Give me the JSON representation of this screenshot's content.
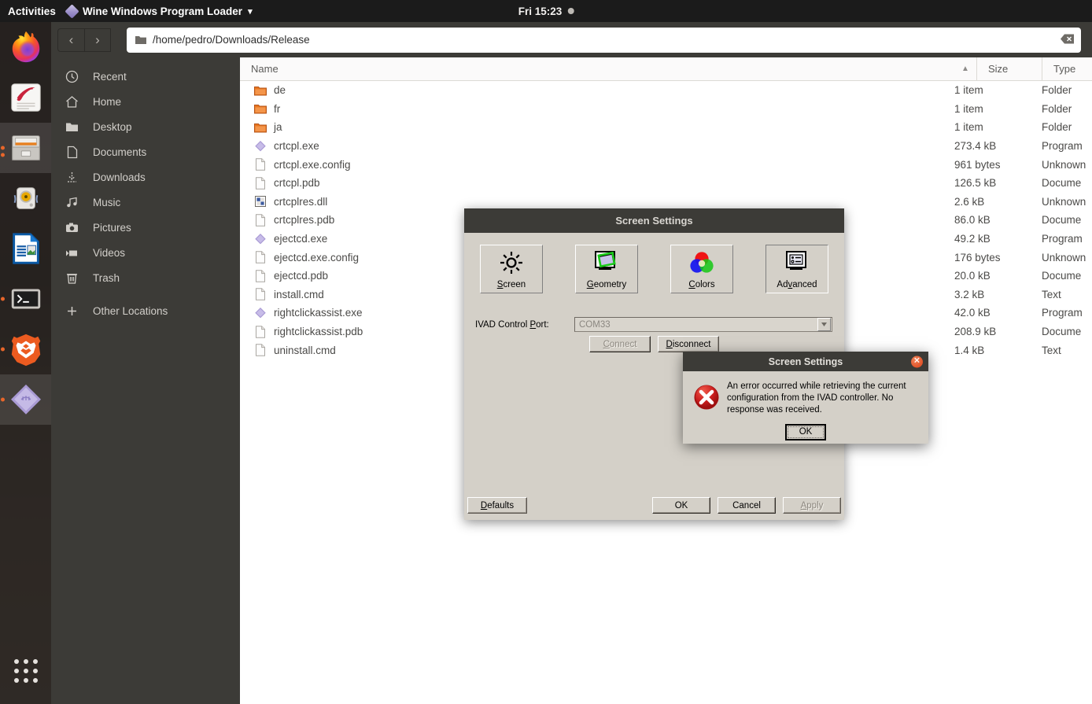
{
  "topbar": {
    "activities": "Activities",
    "app_menu": "Wine Windows Program Loader",
    "app_menu_arrow": "▾",
    "clock": "Fri 15:23"
  },
  "dock": {
    "items": [
      {
        "name": "firefox",
        "running": false
      },
      {
        "name": "evince-document-viewer",
        "running": false
      },
      {
        "name": "file-manager-nautilus",
        "running": true
      },
      {
        "name": "rhythmbox-music-player",
        "running": false
      },
      {
        "name": "libreoffice-impress",
        "running": false
      },
      {
        "name": "terminal",
        "running": true
      },
      {
        "name": "brave-browser",
        "running": true
      },
      {
        "name": "wine-program-loader",
        "running": true
      }
    ],
    "show_apps": "show-applications"
  },
  "filemanager": {
    "nav": {
      "back": "‹",
      "forward": "›"
    },
    "path": "/home/pedro/Downloads/Release",
    "clear_icon": "clear-entry-icon",
    "places": [
      {
        "label": "Recent",
        "icon": "clock-icon"
      },
      {
        "label": "Home",
        "icon": "home-icon"
      },
      {
        "label": "Desktop",
        "icon": "desktop-folder-icon"
      },
      {
        "label": "Documents",
        "icon": "document-icon"
      },
      {
        "label": "Downloads",
        "icon": "download-arrow-icon"
      },
      {
        "label": "Music",
        "icon": "music-note-icon"
      },
      {
        "label": "Pictures",
        "icon": "camera-icon"
      },
      {
        "label": "Videos",
        "icon": "video-camera-icon"
      },
      {
        "label": "Trash",
        "icon": "trash-icon"
      },
      {
        "label": "Other Locations",
        "icon": "plus-icon"
      }
    ],
    "columns": {
      "name": "Name",
      "size": "Size",
      "type": "Type",
      "sort_indicator": "▲"
    },
    "rows": [
      {
        "name": "de",
        "size": "1 item",
        "type": "Folder",
        "icon": "folder"
      },
      {
        "name": "fr",
        "size": "1 item",
        "type": "Folder",
        "icon": "folder"
      },
      {
        "name": "ja",
        "size": "1 item",
        "type": "Folder",
        "icon": "folder"
      },
      {
        "name": "crtcpl.exe",
        "size": "273.4 kB",
        "type": "Program",
        "icon": "exe"
      },
      {
        "name": "crtcpl.exe.config",
        "size": "961 bytes",
        "type": "Unknown",
        "icon": "doc"
      },
      {
        "name": "crtcpl.pdb",
        "size": "126.5 kB",
        "type": "Docume",
        "icon": "doc"
      },
      {
        "name": "crtcplres.dll",
        "size": "2.6 kB",
        "type": "Unknown",
        "icon": "dll"
      },
      {
        "name": "crtcplres.pdb",
        "size": "86.0 kB",
        "type": "Docume",
        "icon": "doc"
      },
      {
        "name": "ejectcd.exe",
        "size": "49.2 kB",
        "type": "Program",
        "icon": "exe"
      },
      {
        "name": "ejectcd.exe.config",
        "size": "176 bytes",
        "type": "Unknown",
        "icon": "doc"
      },
      {
        "name": "ejectcd.pdb",
        "size": "20.0 kB",
        "type": "Docume",
        "icon": "doc"
      },
      {
        "name": "install.cmd",
        "size": "3.2 kB",
        "type": "Text",
        "icon": "doc"
      },
      {
        "name": "rightclickassist.exe",
        "size": "42.0 kB",
        "type": "Program",
        "icon": "exe"
      },
      {
        "name": "rightclickassist.pdb",
        "size": "208.9 kB",
        "type": "Docume",
        "icon": "doc"
      },
      {
        "name": "uninstall.cmd",
        "size": "1.4 kB",
        "type": "Text",
        "icon": "doc"
      }
    ]
  },
  "screen_settings": {
    "title": "Screen Settings",
    "tabs": [
      {
        "label": "Screen",
        "mnemonic": "S",
        "icon": "brightness-sun-icon",
        "selected": false
      },
      {
        "label": "Geometry",
        "mnemonic": "G",
        "icon": "geometry-monitor-icon",
        "selected": false
      },
      {
        "label": "Colors",
        "mnemonic": "C",
        "icon": "rgb-circles-icon",
        "selected": false
      },
      {
        "label": "Advanced",
        "mnemonic": "v",
        "icon": "advanced-monitor-icon",
        "selected": true
      }
    ],
    "port_label": "IVAD Control Port:",
    "port_mnemonic": "P",
    "port_value": "COM33",
    "connect": "Connect",
    "connect_mnemonic": "C",
    "connect_disabled": true,
    "disconnect": "Disconnect",
    "disconnect_mnemonic": "D",
    "defaults": "Defaults",
    "defaults_mnemonic": "D",
    "ok": "OK",
    "cancel": "Cancel",
    "apply": "Apply",
    "apply_mnemonic": "A",
    "apply_disabled": true
  },
  "error_dialog": {
    "title": "Screen Settings",
    "close_glyph": "✕",
    "icon": "error-cross-icon",
    "message": "An error occurred while retrieving the current configuration from the IVAD controller. No response was received.",
    "ok": "OK"
  },
  "colors": {
    "topbar_bg": "#1b1b1b",
    "dock_bg": "#171412",
    "nautilus_chrome": "#3c3b37",
    "wine_face": "#d4d0c8",
    "accent_orange": "#e8662a",
    "error_red": "#cc1f1f"
  }
}
